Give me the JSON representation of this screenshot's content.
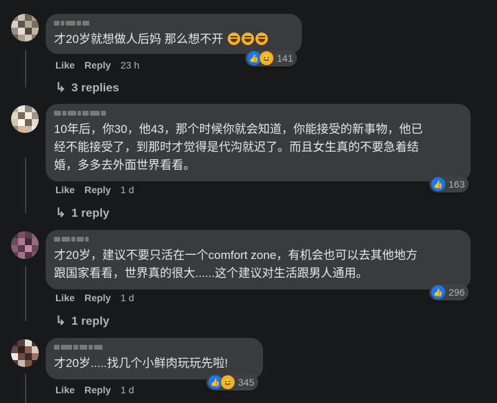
{
  "colors": {
    "background": "#18191a",
    "bubble": "#3a3b3c",
    "like_blue": "#1877f2",
    "haha_yellow": "#f7b125"
  },
  "comments": [
    {
      "text": "才20岁就想做人后妈 那么想不开",
      "emoji": [
        "haha-emoji",
        "haha-emoji",
        "haha-emoji"
      ],
      "like_label": "Like",
      "reply_label": "Reply",
      "time": "23 h",
      "reaction_count": "141",
      "reactions": [
        "like-icon",
        "haha-icon"
      ],
      "replies_label": "3 replies"
    },
    {
      "text_lines": [
        "10年后，你30，他43，那个时候你就会知道，你能接受的新事物，他已",
        "经不能接受了，到那时才觉得是代沟就迟了。而且女生真的不要急着结",
        "婚，多多去外面世界看看。"
      ],
      "like_label": "Like",
      "reply_label": "Reply",
      "time": "1 d",
      "reaction_count": "163",
      "reactions": [
        "like-icon"
      ],
      "replies_label": "1 reply"
    },
    {
      "text_lines": [
        "才20岁，建议不要只活在一个comfort zone，有机会也可以去其他地方",
        "跟国家看看，世界真的很大......这个建议对生活跟男人通用。"
      ],
      "like_label": "Like",
      "reply_label": "Reply",
      "time": "1 d",
      "reaction_count": "296",
      "reactions": [
        "like-icon"
      ],
      "replies_label": "1 reply"
    },
    {
      "text": "才20岁.....找几个小鲜肉玩玩先啦!",
      "like_label": "Like",
      "reply_label": "Reply",
      "time": "1 d",
      "reaction_count": "345",
      "reactions": [
        "like-icon",
        "haha-icon"
      ]
    }
  ]
}
